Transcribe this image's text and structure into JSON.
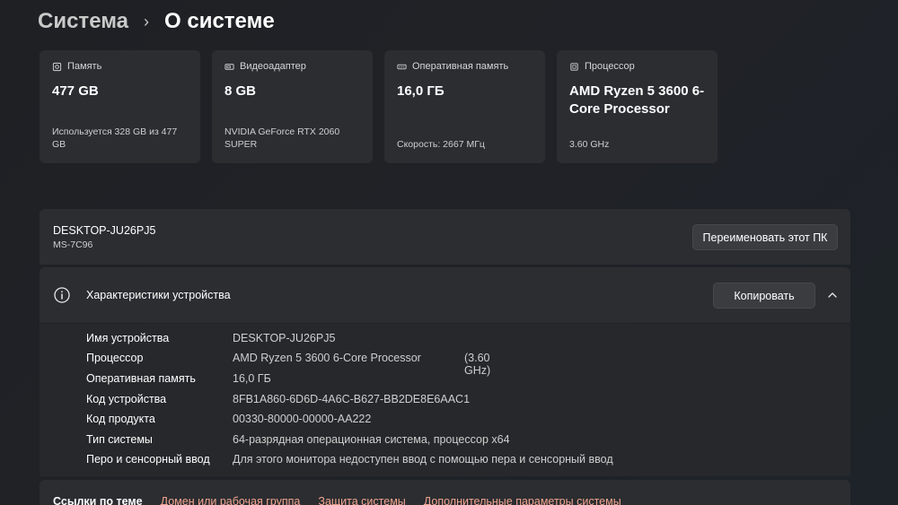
{
  "breadcrumb": {
    "parent": "Система",
    "separator": "›",
    "current": "О системе"
  },
  "cards": [
    {
      "icon": "storage-icon",
      "title": "Память",
      "value": "477 GB",
      "sub": "Используется 328 GB из 477 GB"
    },
    {
      "icon": "display-adapter-icon",
      "title": "Видеоадаптер",
      "value": "8 GB",
      "sub": "NVIDIA GeForce RTX 2060 SUPER"
    },
    {
      "icon": "ram-icon",
      "title": "Оперативная память",
      "value": "16,0 ГБ",
      "sub": "Скорость: 2667 МГц"
    },
    {
      "icon": "cpu-icon",
      "title": "Процессор",
      "value": "AMD Ryzen 5 3600 6-Core Processor",
      "sub": "3.60 GHz"
    }
  ],
  "device": {
    "name": "DESKTOP-JU26PJ5",
    "model": "MS-7C96",
    "rename_label": "Переименовать этот ПК"
  },
  "specs": {
    "title": "Характеристики устройства",
    "copy_label": "Копировать",
    "rows": [
      {
        "label": "Имя устройства",
        "value": "DESKTOP-JU26PJ5"
      },
      {
        "label": "Процессор",
        "value": "AMD Ryzen 5 3600 6-Core Processor",
        "extra": "(3.60 GHz)"
      },
      {
        "label": "Оперативная память",
        "value": "16,0 ГБ"
      },
      {
        "label": "Код устройства",
        "value": "8FB1A860-6D6D-4A6C-B627-BB2DE8E6AAC1"
      },
      {
        "label": "Код продукта",
        "value": "00330-80000-00000-AA222"
      },
      {
        "label": "Тип системы",
        "value": "64-разрядная операционная система, процессор x64"
      },
      {
        "label": "Перо и сенсорный ввод",
        "value": "Для этого монитора недоступен ввод с помощью пера и сенсорный ввод"
      }
    ]
  },
  "links": {
    "title": "Ссылки по теме",
    "items": [
      "Домен или рабочая группа",
      "Защита системы",
      "Дополнительные параметры системы"
    ]
  },
  "colors": {
    "link": "#f2a58f",
    "card_bg": "#2b2d31",
    "page_bg": "#202227"
  }
}
